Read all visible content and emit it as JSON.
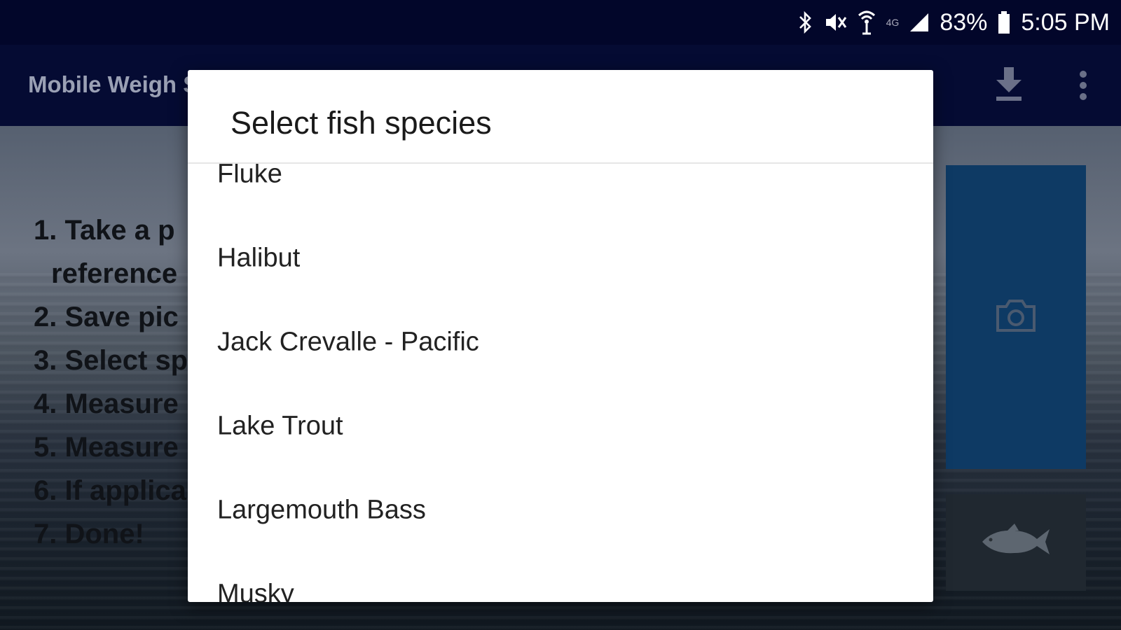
{
  "status_bar": {
    "battery": "83%",
    "time": "5:05 PM",
    "network_label": "4G",
    "icons": [
      "bluetooth-icon",
      "mute-icon",
      "wifi-icon",
      "network-icon",
      "signal-icon",
      "battery-icon"
    ]
  },
  "app_bar": {
    "title": "Mobile Weigh S",
    "actions": [
      "download-icon",
      "overflow-menu-icon"
    ]
  },
  "instructions": [
    "1. Take a p",
    "reference",
    "2. Save pic",
    "3. Select sp",
    "4. Measure",
    "5. Measure",
    "6. If applica",
    "7. Done!"
  ],
  "side_buttons": [
    "camera-icon",
    "fish-icon"
  ],
  "dialog": {
    "title": "Select fish species",
    "species": [
      "Fluke",
      "Halibut",
      "Jack Crevalle - Pacific",
      "Lake Trout",
      "Largemouth Bass",
      "Musky"
    ]
  },
  "colors": {
    "status_bar": "#02062a",
    "app_bar": "#050b33",
    "camera_panel": "#0e3a64",
    "dialog_bg": "#ffffff"
  }
}
